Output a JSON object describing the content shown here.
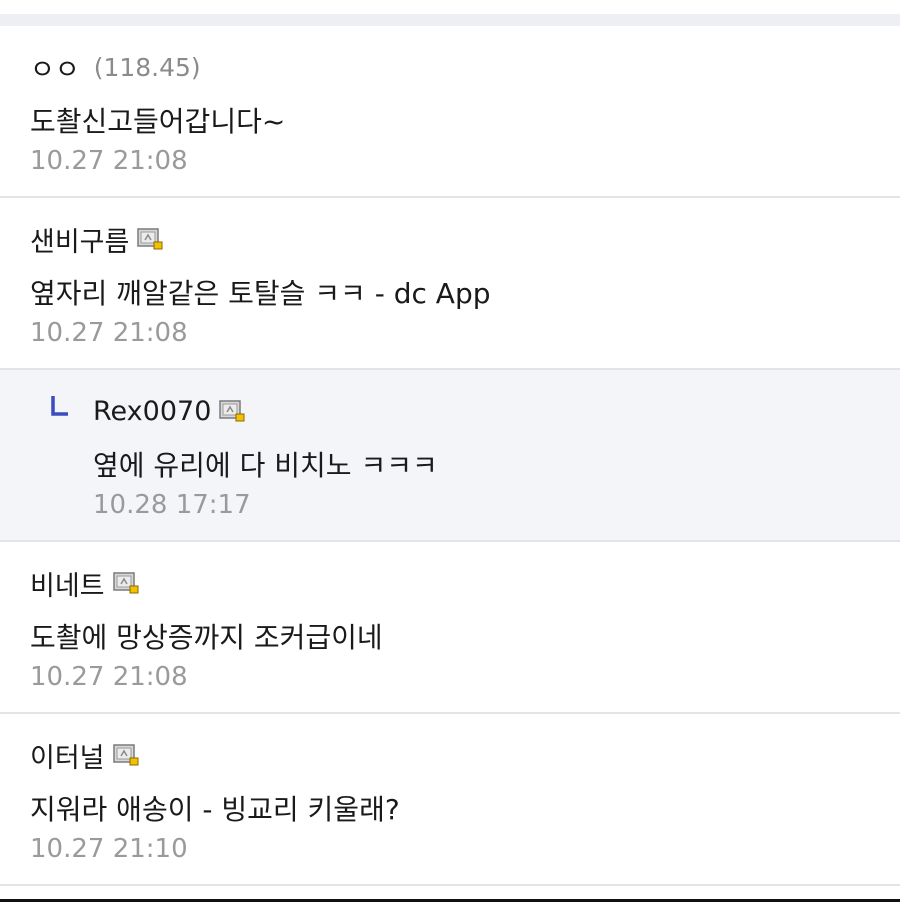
{
  "comments": [
    {
      "author": "ㅇㅇ",
      "ip": "(118.45)",
      "text": "도촬신고들어갑니다~",
      "time": "10.27 21:08"
    },
    {
      "author": "샌비구름",
      "text": "옆자리 깨알같은 토탈슬 ㅋㅋ - dc App",
      "time": "10.27 21:08"
    },
    {
      "author": "Rex0070",
      "text": "옆에 유리에 다 비치노 ㅋㅋㅋ",
      "time": "10.28 17:17",
      "is_reply": true
    },
    {
      "author": "비네트",
      "text": "도촬에 망상증까지 조커급이네",
      "time": "10.27 21:08"
    },
    {
      "author": "이터널",
      "text": "지워라 애송이 - 빙교리 키울래?",
      "time": "10.27 21:10"
    }
  ],
  "colors": {
    "reply_bg": "#f4f5f9",
    "reply_arrow": "#3b4cc0",
    "meta_gray": "#9a9a9a"
  }
}
